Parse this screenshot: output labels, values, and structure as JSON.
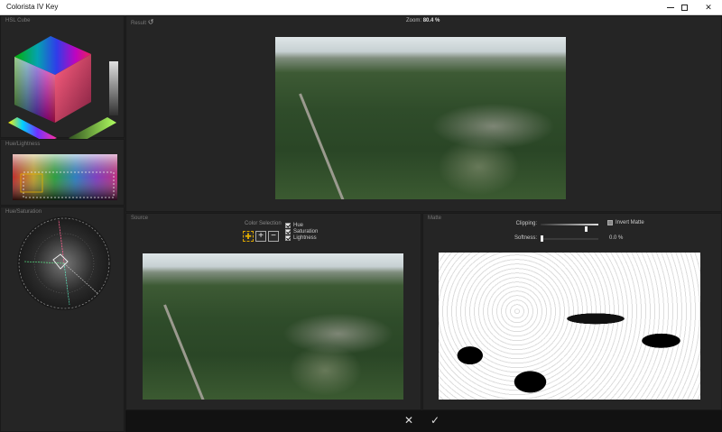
{
  "window": {
    "title": "Colorista IV Key",
    "minimize_icon": "minimize-icon",
    "maximize_icon": "maximize-icon",
    "close_glyph": "✕"
  },
  "panels": {
    "hsl_cube": {
      "label": "HSL Cube"
    },
    "hue_lightness": {
      "label": "Hue/Lightness"
    },
    "hue_saturation": {
      "label": "Hue/Saturation"
    },
    "result": {
      "label": "Result",
      "reset_glyph": "↺"
    },
    "source": {
      "label": "Source"
    },
    "matte": {
      "label": "Matte"
    }
  },
  "zoom": {
    "label": "Zoom:",
    "value": "80.4 %"
  },
  "color_selection": {
    "label": "Color Selection",
    "tools": [
      {
        "name": "eyedropper",
        "glyph": "✚"
      },
      {
        "name": "add",
        "glyph": "+"
      },
      {
        "name": "subtract",
        "glyph": "−"
      }
    ],
    "checkboxes": [
      {
        "label": "Hue",
        "checked": true
      },
      {
        "label": "Saturation",
        "checked": true
      },
      {
        "label": "Lightness",
        "checked": true
      }
    ]
  },
  "matte_controls": {
    "clipping_label": "Clipping:",
    "softness_label": "Softness:",
    "softness_value": "0.0 %",
    "invert_label": "Invert Matte",
    "invert_checked": false
  },
  "footer": {
    "cancel_glyph": "✕",
    "ok_glyph": "✓"
  },
  "colors": {
    "panel_bg": "#252525",
    "bar_bg": "#121212",
    "eyedropper_accent": "#e5b100"
  }
}
